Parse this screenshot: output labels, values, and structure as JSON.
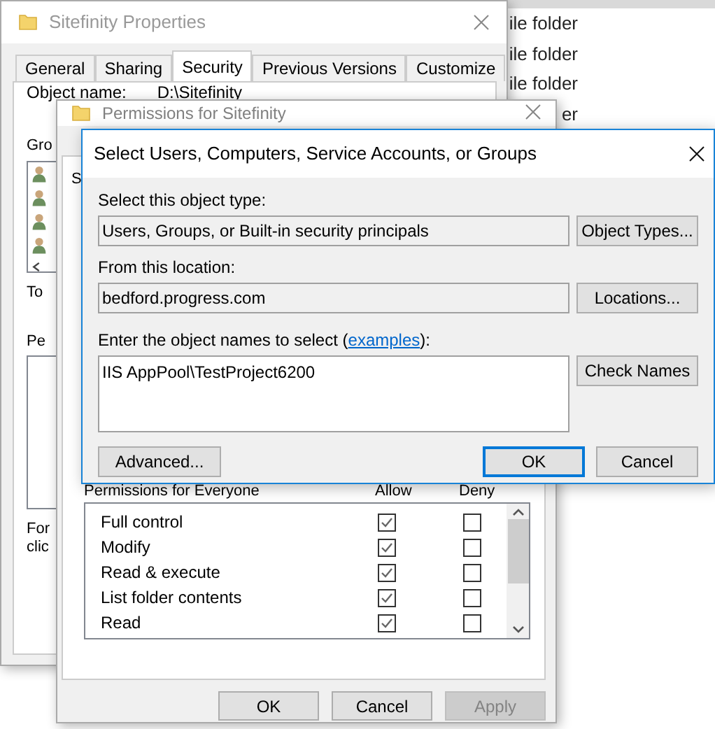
{
  "explorer": {
    "rows": [
      "ile folder",
      "ile folder",
      "ile folder",
      "er"
    ]
  },
  "properties_window": {
    "title": "Sitefinity Properties",
    "tabs": [
      {
        "label": "General",
        "selected": false
      },
      {
        "label": "Sharing",
        "selected": false
      },
      {
        "label": "Security",
        "selected": true
      },
      {
        "label": "Previous Versions",
        "selected": false
      },
      {
        "label": "Customize",
        "selected": false
      }
    ],
    "object_name_label": "Object name:",
    "object_name_value": "D:\\Sitefinity",
    "group_label": "Gro",
    "to_label": "To",
    "permissions_label": "Pe",
    "footer_lines": [
      "For",
      "clic"
    ]
  },
  "permissions_window": {
    "title": "Permissions for Sitefinity",
    "tab_label": "S",
    "list_header": {
      "name": "Permissions for Everyone",
      "allow": "Allow",
      "deny": "Deny"
    },
    "permissions": [
      {
        "name": "Full control",
        "allow": true,
        "deny": false
      },
      {
        "name": "Modify",
        "allow": true,
        "deny": false
      },
      {
        "name": "Read & execute",
        "allow": true,
        "deny": false
      },
      {
        "name": "List folder contents",
        "allow": true,
        "deny": false
      },
      {
        "name": "Read",
        "allow": true,
        "deny": false
      }
    ],
    "buttons": [
      {
        "label": "OK",
        "disabled": false
      },
      {
        "label": "Cancel",
        "disabled": false
      },
      {
        "label": "Apply",
        "disabled": true
      }
    ]
  },
  "select_dialog": {
    "title": "Select Users, Computers, Service Accounts, or Groups",
    "object_type_label": "Select this object type:",
    "object_type_value": "Users, Groups, or Built-in security principals",
    "object_types_button": "Object Types...",
    "location_label": "From this location:",
    "location_value": "bedford.progress.com",
    "locations_button": "Locations...",
    "names_label_before": "Enter the object names to select (",
    "names_link": "examples",
    "names_label_after": "):",
    "names_value": "IIS AppPool\\TestProject6200",
    "check_names_button": "Check Names",
    "advanced_button": "Advanced...",
    "ok_button": "OK",
    "cancel_button": "Cancel"
  }
}
